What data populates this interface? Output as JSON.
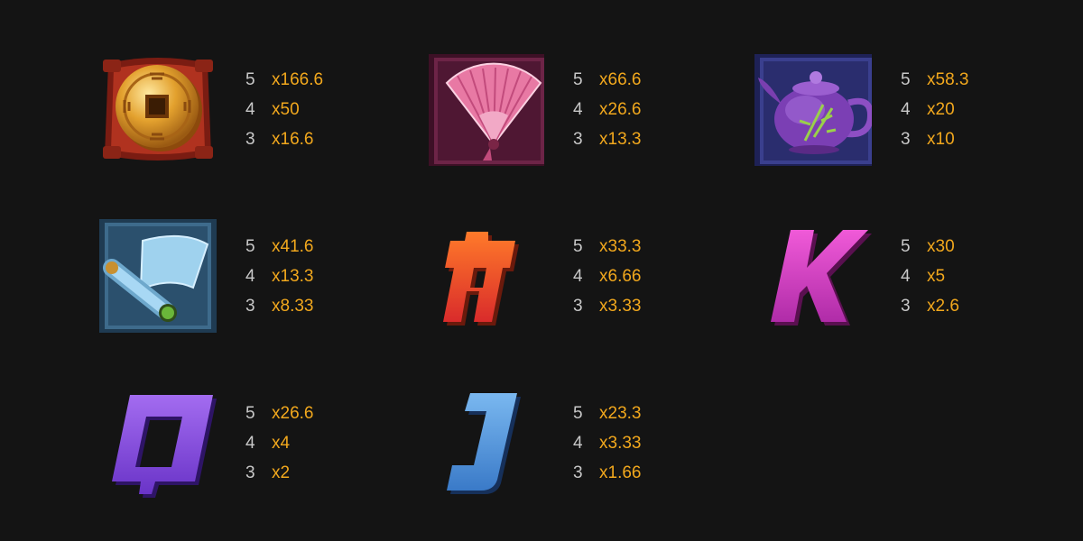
{
  "symbols": [
    {
      "name": "coin",
      "pays": [
        {
          "count": "5",
          "mult": "x166.6"
        },
        {
          "count": "4",
          "mult": "x50"
        },
        {
          "count": "3",
          "mult": "x16.6"
        }
      ]
    },
    {
      "name": "fan",
      "pays": [
        {
          "count": "5",
          "mult": "x66.6"
        },
        {
          "count": "4",
          "mult": "x26.6"
        },
        {
          "count": "3",
          "mult": "x13.3"
        }
      ]
    },
    {
      "name": "teapot",
      "pays": [
        {
          "count": "5",
          "mult": "x58.3"
        },
        {
          "count": "4",
          "mult": "x20"
        },
        {
          "count": "3",
          "mult": "x10"
        }
      ]
    },
    {
      "name": "scroll",
      "pays": [
        {
          "count": "5",
          "mult": "x41.6"
        },
        {
          "count": "4",
          "mult": "x13.3"
        },
        {
          "count": "3",
          "mult": "x8.33"
        }
      ]
    },
    {
      "name": "A",
      "pays": [
        {
          "count": "5",
          "mult": "x33.3"
        },
        {
          "count": "4",
          "mult": "x6.66"
        },
        {
          "count": "3",
          "mult": "x3.33"
        }
      ]
    },
    {
      "name": "K",
      "pays": [
        {
          "count": "5",
          "mult": "x30"
        },
        {
          "count": "4",
          "mult": "x5"
        },
        {
          "count": "3",
          "mult": "x2.6"
        }
      ]
    },
    {
      "name": "Q",
      "pays": [
        {
          "count": "5",
          "mult": "x26.6"
        },
        {
          "count": "4",
          "mult": "x4"
        },
        {
          "count": "3",
          "mult": "x2"
        }
      ]
    },
    {
      "name": "J",
      "pays": [
        {
          "count": "5",
          "mult": "x23.3"
        },
        {
          "count": "4",
          "mult": "x3.33"
        },
        {
          "count": "3",
          "mult": "x1.66"
        }
      ]
    }
  ],
  "colors": {
    "background": "#141414",
    "count_text": "#c8c8c8",
    "multiplier_text": "#f2a81d"
  },
  "icons": [
    "coin-icon",
    "fan-icon",
    "teapot-icon",
    "scroll-icon",
    "letter-a-icon",
    "letter-k-icon",
    "letter-q-icon",
    "letter-j-icon"
  ]
}
